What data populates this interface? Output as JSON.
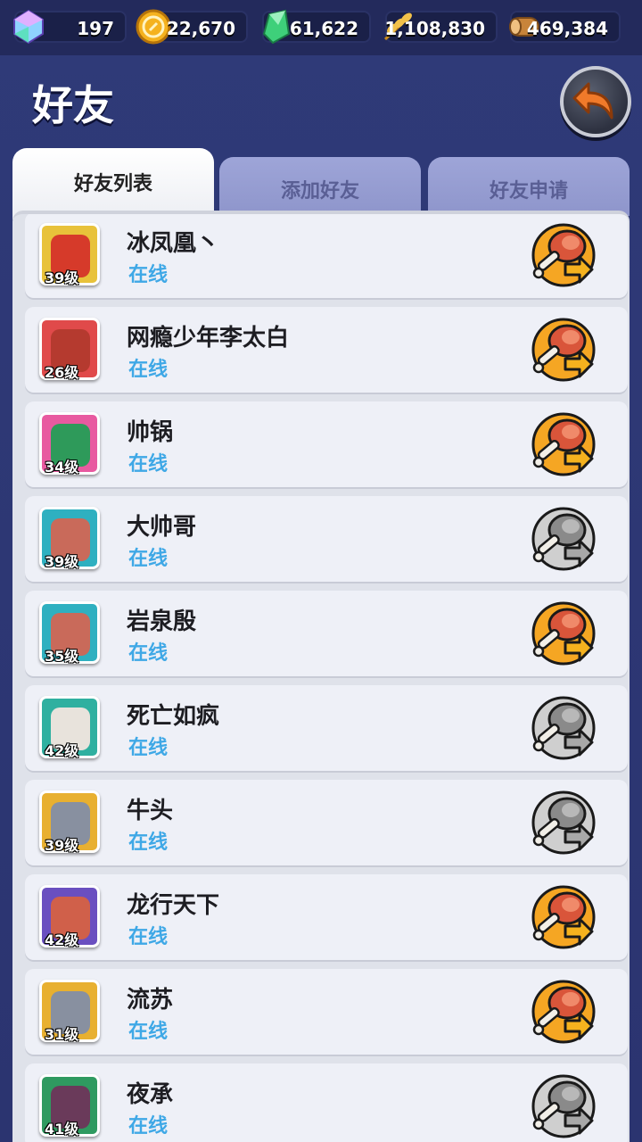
{
  "currencies": [
    {
      "icon": "gem-icon",
      "value": "197"
    },
    {
      "icon": "coin-icon",
      "value": "22,670"
    },
    {
      "icon": "green-crystal-icon",
      "value": "61,622"
    },
    {
      "icon": "wheat-icon",
      "value": "1,108,830"
    },
    {
      "icon": "wood-icon",
      "value": "469,384"
    }
  ],
  "header": {
    "title": "好友"
  },
  "tabs": [
    {
      "label": "好友列表",
      "active": true
    },
    {
      "label": "添加好友",
      "active": false
    },
    {
      "label": "好友申请",
      "active": false
    }
  ],
  "friends": [
    {
      "name": "冰凤凰丶",
      "level": "39级",
      "status": "在线",
      "gift_active": true,
      "avatar_bg": "#e8c23a",
      "face": "#d63a2a"
    },
    {
      "name": "网瘾少年李太白",
      "level": "26级",
      "status": "在线",
      "gift_active": true,
      "avatar_bg": "#e04a4a",
      "face": "#b53a2f"
    },
    {
      "name": "帅锅",
      "level": "34级",
      "status": "在线",
      "gift_active": true,
      "avatar_bg": "#e85aa0",
      "face": "#2e9a5a"
    },
    {
      "name": "大帅哥",
      "level": "39级",
      "status": "在线",
      "gift_active": false,
      "avatar_bg": "#2fb0c0",
      "face": "#c96a5a"
    },
    {
      "name": "岩泉殷",
      "level": "35级",
      "status": "在线",
      "gift_active": true,
      "avatar_bg": "#2fb0c0",
      "face": "#c96a5a"
    },
    {
      "name": "死亡如疯",
      "level": "42级",
      "status": "在线",
      "gift_active": false,
      "avatar_bg": "#2fb0a0",
      "face": "#e8e3dc"
    },
    {
      "name": "牛头",
      "level": "39级",
      "status": "在线",
      "gift_active": false,
      "avatar_bg": "#e8b030",
      "face": "#8890a0"
    },
    {
      "name": "龙行天下",
      "level": "42级",
      "status": "在线",
      "gift_active": true,
      "avatar_bg": "#6a4fc0",
      "face": "#d0604a"
    },
    {
      "name": "流苏",
      "level": "31级",
      "status": "在线",
      "gift_active": true,
      "avatar_bg": "#e8b030",
      "face": "#8890a0"
    },
    {
      "name": "夜承",
      "level": "41级",
      "status": "在线",
      "gift_active": false,
      "avatar_bg": "#2f9a60",
      "face": "#6a3a5a"
    }
  ],
  "colors": {
    "online": "#3fa8e6",
    "gift_active": "#f5a623",
    "gift_inactive": "#9a9a9a"
  }
}
